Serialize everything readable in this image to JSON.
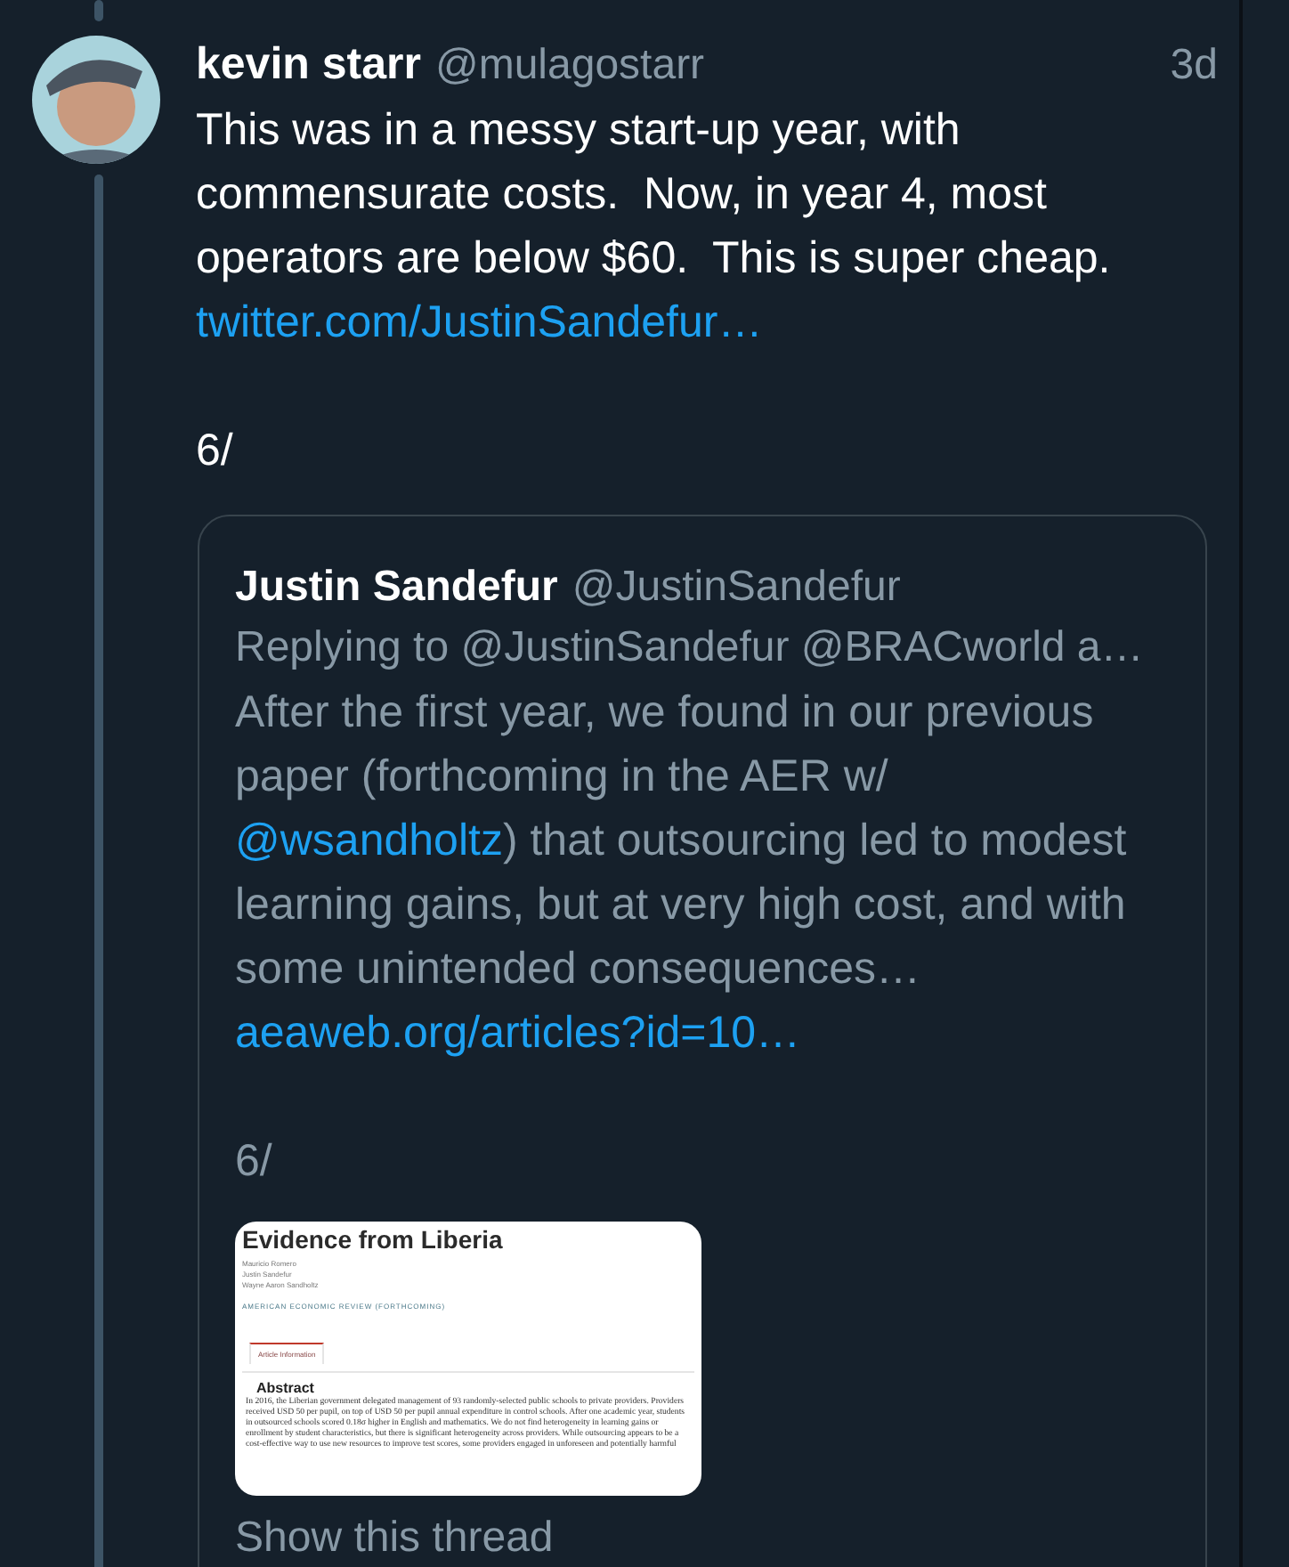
{
  "tweet": {
    "author_name": "kevin starr",
    "handle": "@mulagostarr",
    "time": "3d",
    "text": "This was in a messy start-up year, with commensurate costs.  Now, in year 4, most operators are below $60.  This is super cheap.",
    "link": "twitter.com/JustinSandefur…",
    "thread_marker": "6/"
  },
  "quoted_tweet": {
    "author_name": "Justin Sandefur",
    "handle": "@JustinSandefur",
    "replying_to": "Replying to @JustinSandefur @BRACworld a…",
    "text_before": "After the first year, we found in our previous paper (forthcoming in the AER w/ ",
    "mention": "@wsandholtz",
    "text_after": ") that outsourcing led to modest learning gains, but at very high cost, and with some unintended consequences…",
    "link": "aeaweb.org/articles?id=10…",
    "thread_marker": "6/",
    "document_preview": {
      "title": "Evidence from Liberia",
      "authors": [
        "Mauricio Romero",
        "Justin Sandefur",
        "Wayne Aaron Sandholtz"
      ],
      "journal": "AMERICAN ECONOMIC REVIEW (FORTHCOMING)",
      "tab": "Article Information",
      "heading": "Abstract",
      "abstract": "In 2016, the Liberian government delegated management of 93 randomly-selected public schools to private providers. Providers received USD 50 per pupil, on top of USD 50 per pupil annual expenditure in control schools. After one academic year, students in outsourced schools scored 0.18σ higher in English and mathematics. We do not find heterogeneity in learning gains or enrollment by student characteristics, but there is significant heterogeneity across providers. While outsourcing appears to be a cost-effective way to use new resources to improve test scores, some providers engaged in unforeseen and potentially harmful"
    }
  },
  "show_thread": "Show this thread"
}
